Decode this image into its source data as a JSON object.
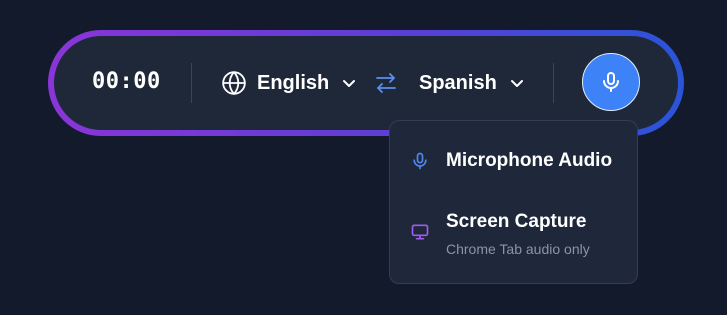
{
  "toolbar": {
    "timer": "00:00",
    "source_language": "English",
    "target_language": "Spanish",
    "icons": {
      "globe": "globe-icon",
      "swap": "swap-arrows-icon",
      "chevron": "chevron-down-icon",
      "mic": "microphone-icon"
    }
  },
  "audio_menu": {
    "items": [
      {
        "label": "Microphone Audio",
        "icon": "microphone-icon"
      },
      {
        "label": "Screen Capture",
        "sublabel": "Chrome Tab audio only",
        "icon": "monitor-icon"
      }
    ]
  },
  "colors": {
    "background": "#121a2b",
    "pill": "#1e2839",
    "gradient_start": "#8a35d8",
    "gradient_end": "#2a54d8",
    "accent_blue": "#3d82f6",
    "accent_purple": "#a25bf0",
    "swap_icon": "#5b8ef0"
  }
}
